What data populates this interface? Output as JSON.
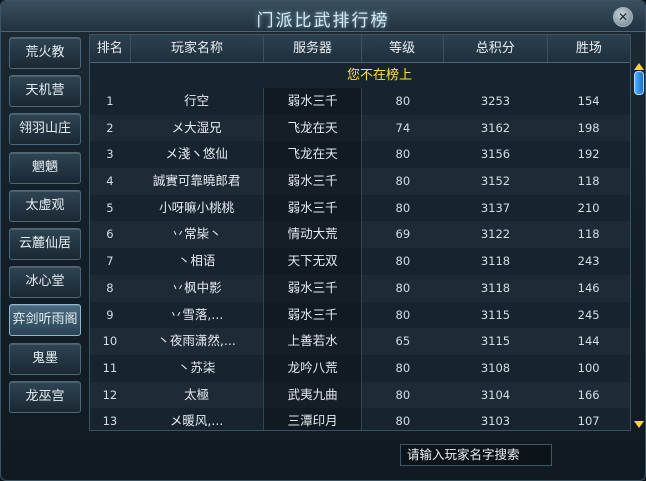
{
  "window": {
    "title": "门派比武排行榜",
    "close_icon": "close-icon"
  },
  "sidebar": {
    "items": [
      {
        "label": "荒火教"
      },
      {
        "label": "天机营"
      },
      {
        "label": "翎羽山庄"
      },
      {
        "label": "魍魉"
      },
      {
        "label": "太虚观"
      },
      {
        "label": "云麓仙居"
      },
      {
        "label": "冰心堂"
      },
      {
        "label": "弈剑听雨阁"
      },
      {
        "label": "鬼墨"
      },
      {
        "label": "龙巫宫"
      }
    ]
  },
  "table": {
    "headers": [
      "排名",
      "玩家名称",
      "服务器",
      "等级",
      "总积分",
      "胜场"
    ],
    "notice": "您不在榜上",
    "rows": [
      [
        "1",
        "行空",
        "弱水三千",
        "80",
        "3253",
        "154"
      ],
      [
        "2",
        "メ大湿兄",
        "飞龙在天",
        "74",
        "3162",
        "198"
      ],
      [
        "3",
        "メ淺ヽ悠仙",
        "飞龙在天",
        "80",
        "3156",
        "192"
      ],
      [
        "4",
        "誠實可靠曉郎君",
        "弱水三千",
        "80",
        "3152",
        "118"
      ],
      [
        "5",
        "小呀嘛小桃桃",
        "弱水三千",
        "80",
        "3137",
        "210"
      ],
      [
        "6",
        "丷常枈丶",
        "情动大荒",
        "69",
        "3122",
        "118"
      ],
      [
        "7",
        "丶相语",
        "天下无双",
        "80",
        "3118",
        "243"
      ],
      [
        "8",
        "丷枫中影",
        "弱水三千",
        "80",
        "3118",
        "146"
      ],
      [
        "9",
        "丷雪落,...",
        "弱水三千",
        "80",
        "3115",
        "245"
      ],
      [
        "10",
        "丶夜雨潇然,...",
        "上善若水",
        "65",
        "3115",
        "144"
      ],
      [
        "11",
        "丶苏柒",
        "龙吟八荒",
        "80",
        "3108",
        "100"
      ],
      [
        "12",
        "太極",
        "武夷九曲",
        "80",
        "3104",
        "166"
      ],
      [
        "13",
        "メ暖风,...",
        "三潭印月",
        "80",
        "3103",
        "107"
      ]
    ]
  },
  "search": {
    "placeholder": "请输入玩家名字搜索"
  },
  "colors": {
    "notice": "#ffe23a",
    "scroll_thumb": "#3a97ef",
    "scroll_arrows": "#ffd23b"
  }
}
